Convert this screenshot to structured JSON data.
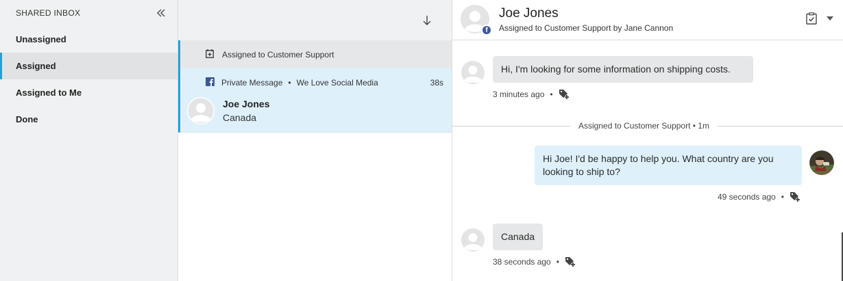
{
  "sidebar": {
    "title": "SHARED INBOX",
    "collapse_icon": "double-chevron-left-icon",
    "items": [
      {
        "label": "Unassigned",
        "active": false
      },
      {
        "label": "Assigned",
        "active": true
      },
      {
        "label": "Assigned to Me",
        "active": false
      },
      {
        "label": "Done",
        "active": false
      }
    ]
  },
  "list": {
    "sort_icon": "arrow-down-icon",
    "group_label": "Assigned to Customer Support",
    "conversation": {
      "channel": "Private Message",
      "page": "We Love Social Media",
      "separator": "•",
      "time": "38s",
      "name": "Joe Jones",
      "location": "Canada"
    }
  },
  "detail": {
    "name": "Joe Jones",
    "subtitle": "Assigned to Customer Support by Jane Cannon",
    "badge": "f",
    "messages": [
      {
        "direction": "in",
        "text": "Hi, I'm looking for some information on shipping costs.",
        "time": "3 minutes ago"
      },
      {
        "direction": "out",
        "text": "Hi Joe! I'd be happy to help you. What country are you looking to ship to?",
        "time": "49 seconds ago"
      },
      {
        "direction": "in",
        "text": "Canada",
        "time": "38 seconds ago"
      }
    ],
    "divider": "Assigned to Customer Support • 1m",
    "separator": "•"
  },
  "colors": {
    "accent": "#1fa2d8",
    "facebook": "#3b5998",
    "selected_bg": "#def1fb"
  }
}
